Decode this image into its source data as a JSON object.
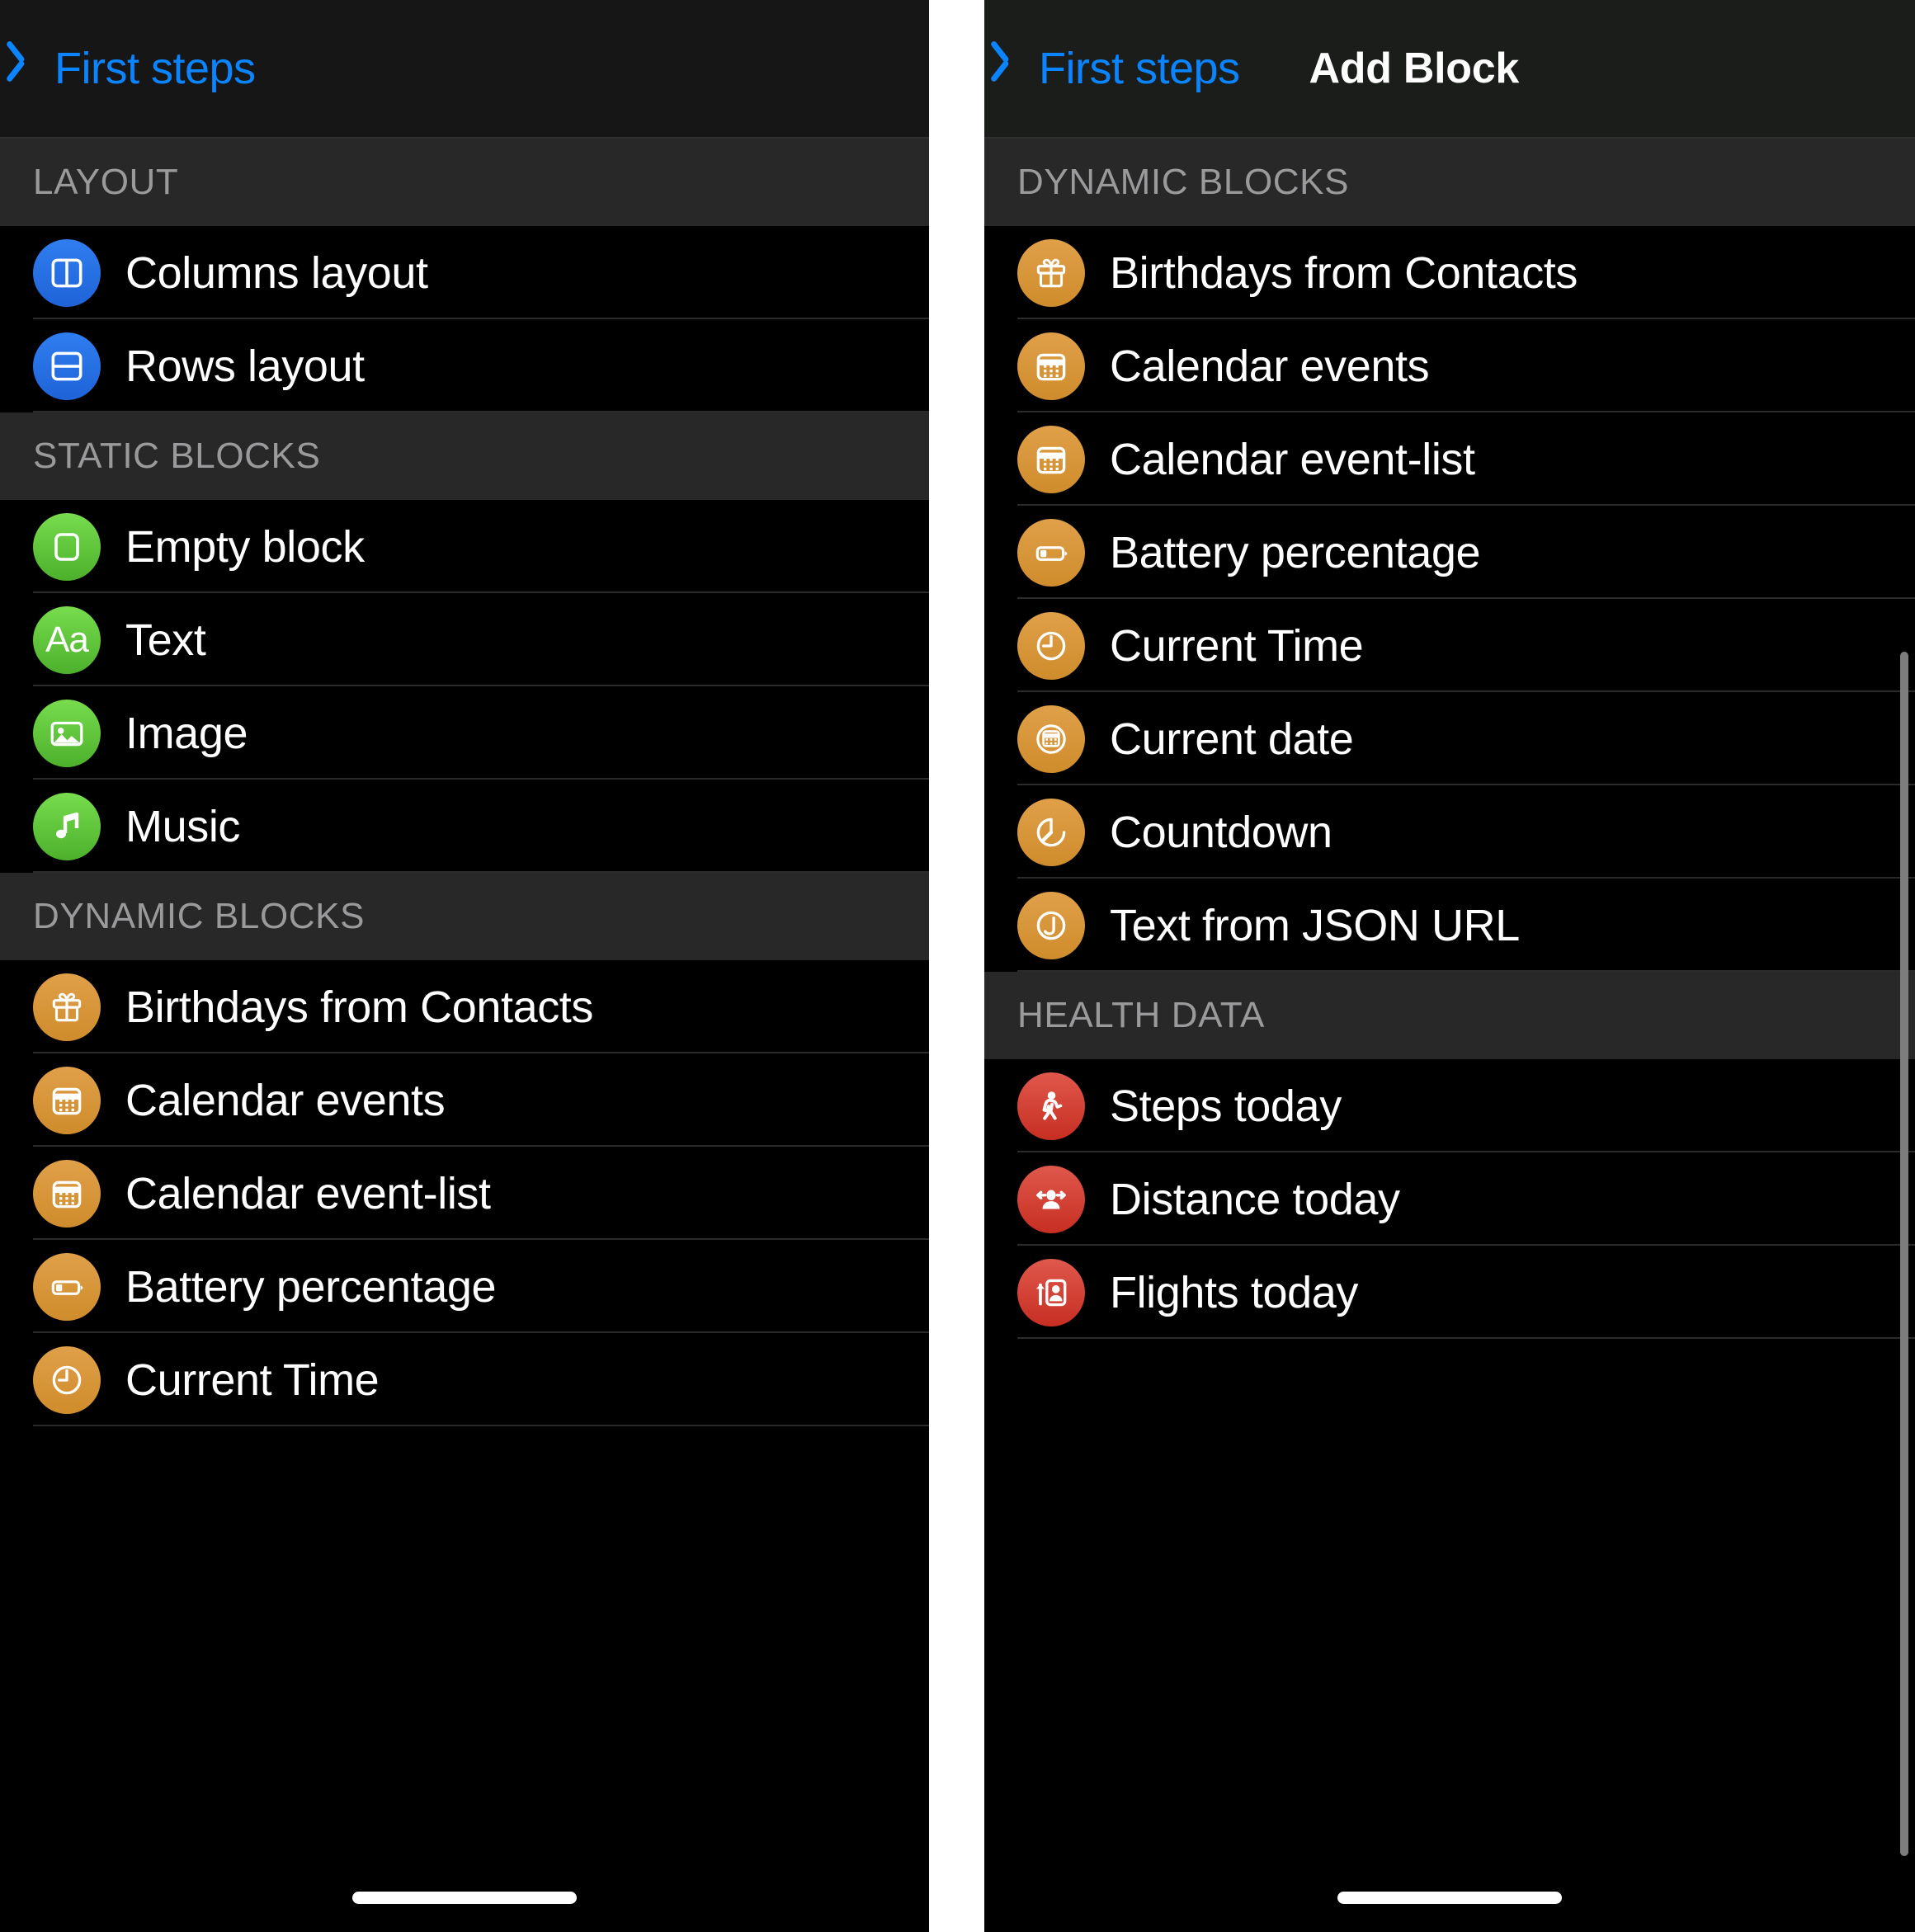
{
  "left_screen": {
    "nav": {
      "back_label": "First steps",
      "back_icon": "chevron-left-icon",
      "title": ""
    },
    "sections": [
      {
        "header": "LAYOUT",
        "items": [
          {
            "label": "Columns layout",
            "icon": "columns-layout-icon",
            "color": "blue"
          },
          {
            "label": "Rows layout",
            "icon": "rows-layout-icon",
            "color": "blue"
          }
        ]
      },
      {
        "header": "STATIC BLOCKS",
        "items": [
          {
            "label": "Empty block",
            "icon": "empty-block-icon",
            "color": "green"
          },
          {
            "label": "Text",
            "icon": "text-aa-icon",
            "color": "green"
          },
          {
            "label": "Image",
            "icon": "image-icon",
            "color": "green"
          },
          {
            "label": "Music",
            "icon": "music-note-icon",
            "color": "green"
          }
        ]
      },
      {
        "header": "DYNAMIC BLOCKS",
        "items": [
          {
            "label": "Birthdays from Contacts",
            "icon": "gift-icon",
            "color": "orange"
          },
          {
            "label": "Calendar events",
            "icon": "calendar-icon",
            "color": "orange"
          },
          {
            "label": "Calendar event-list",
            "icon": "calendar-icon",
            "color": "orange"
          },
          {
            "label": "Battery percentage",
            "icon": "battery-icon",
            "color": "orange"
          },
          {
            "label": "Current Time",
            "icon": "clock-icon",
            "color": "orange"
          }
        ]
      }
    ]
  },
  "right_screen": {
    "nav": {
      "back_label": "First steps",
      "back_icon": "chevron-left-icon",
      "title": "Add Block"
    },
    "sections": [
      {
        "header": "DYNAMIC BLOCKS",
        "items": [
          {
            "label": "Birthdays from Contacts",
            "icon": "gift-icon",
            "color": "orange"
          },
          {
            "label": "Calendar events",
            "icon": "calendar-icon",
            "color": "orange"
          },
          {
            "label": "Calendar event-list",
            "icon": "calendar-icon",
            "color": "orange"
          },
          {
            "label": "Battery percentage",
            "icon": "battery-icon",
            "color": "orange"
          },
          {
            "label": "Current Time",
            "icon": "clock-icon",
            "color": "orange"
          },
          {
            "label": "Current date",
            "icon": "calendar-circle-icon",
            "color": "orange"
          },
          {
            "label": "Countdown",
            "icon": "timer-icon",
            "color": "orange"
          },
          {
            "label": "Text from JSON URL",
            "icon": "json-circle-icon",
            "color": "orange"
          }
        ]
      },
      {
        "header": "HEALTH DATA",
        "items": [
          {
            "label": "Steps today",
            "icon": "walking-figure-icon",
            "color": "red"
          },
          {
            "label": "Distance today",
            "icon": "distance-person-icon",
            "color": "red"
          },
          {
            "label": "Flights today",
            "icon": "flights-person-icon",
            "color": "red"
          }
        ]
      }
    ],
    "scrollbar_visible": true
  },
  "colors": {
    "accent_blue": "#0a84ff",
    "icon_blue": "#2f7ef0",
    "icon_green": "#5fc83c",
    "icon_orange": "#d9973a",
    "icon_red": "#d63f32",
    "section_header_bg": "#282828",
    "section_header_text": "#9a9a9c",
    "row_bg": "#000000",
    "separator": "#2b2b2b"
  }
}
